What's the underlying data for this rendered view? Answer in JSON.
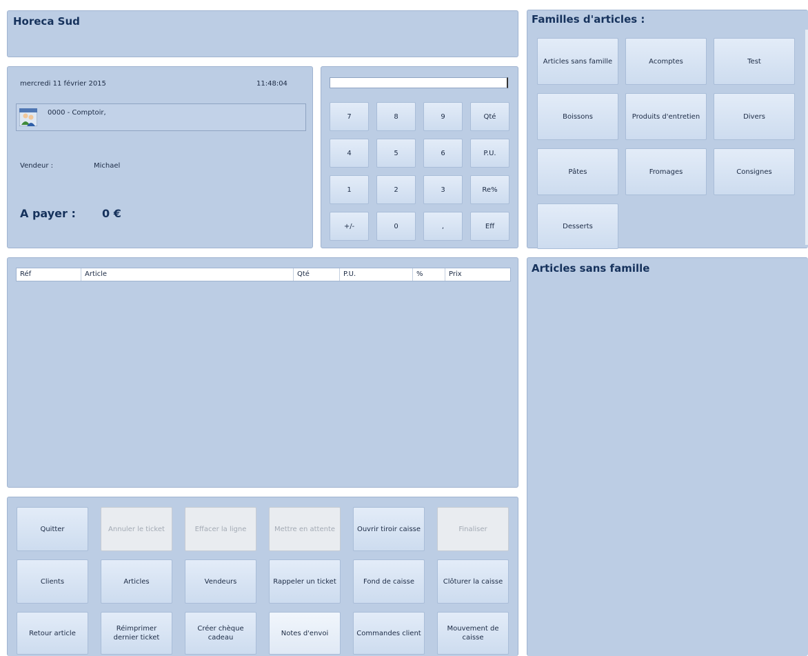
{
  "store": {
    "name": "Horeca Sud"
  },
  "info": {
    "date": "mercredi 11 février 2015",
    "time": "11:48:04",
    "customer": "0000 - Comptoir,",
    "vendor_label": "Vendeur :",
    "vendor_name": "Michael",
    "total_label": "A payer :",
    "total_value": "0 €"
  },
  "keypad": {
    "display_value": "",
    "keys": [
      "7",
      "8",
      "9",
      "Qté",
      "4",
      "5",
      "6",
      "P.U.",
      "1",
      "2",
      "3",
      "Re%",
      "+/-",
      "0",
      ",",
      "Eff"
    ]
  },
  "families": {
    "title": "Familles d'articles :",
    "items": [
      "Articles sans famille",
      "Acomptes",
      "Test",
      "Boissons",
      "Produits d'entretien",
      "Divers",
      "Pâtes",
      "Fromages",
      "Consignes",
      "Desserts"
    ]
  },
  "table": {
    "columns": [
      "Réf",
      "Article",
      "Qté",
      "P.U.",
      "%",
      "Prix"
    ]
  },
  "articles": {
    "title": "Articles sans famille"
  },
  "actions": [
    {
      "label": "Quitter",
      "enabled": true
    },
    {
      "label": "Annuler le ticket",
      "enabled": false
    },
    {
      "label": "Effacer la ligne",
      "enabled": false
    },
    {
      "label": "Mettre en attente",
      "enabled": false
    },
    {
      "label": "Ouvrir tiroir caisse",
      "enabled": true
    },
    {
      "label": "Finaliser",
      "enabled": false
    },
    {
      "label": "Clients",
      "enabled": true
    },
    {
      "label": "Articles",
      "enabled": true
    },
    {
      "label": "Vendeurs",
      "enabled": true
    },
    {
      "label": "Rappeler un ticket",
      "enabled": true
    },
    {
      "label": "Fond de caisse",
      "enabled": true
    },
    {
      "label": "Clôturer la caisse",
      "enabled": true
    },
    {
      "label": "Retour article",
      "enabled": true
    },
    {
      "label": "Réimprimer dernier ticket",
      "enabled": true
    },
    {
      "label": "Créer chèque cadeau",
      "enabled": true
    },
    {
      "label": "Notes d'envoi",
      "enabled": true
    },
    {
      "label": "Commandes client",
      "enabled": true
    },
    {
      "label": "Mouvement de caisse",
      "enabled": true
    }
  ]
}
